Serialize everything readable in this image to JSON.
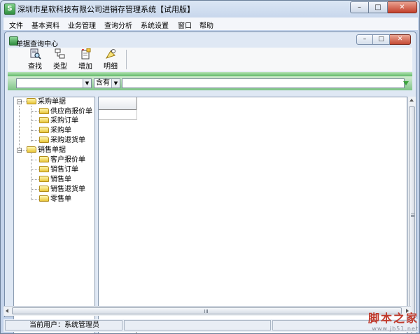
{
  "window": {
    "title": "深圳市星软科技有限公司进销存管理系统【试用版】",
    "controls": {
      "minimize": "–",
      "maximize": "□",
      "close": "✕"
    }
  },
  "menu": [
    "文件",
    "基本资料",
    "业务管理",
    "查询分析",
    "系统设置",
    "窗口",
    "帮助"
  ],
  "child_window": {
    "title": "单据查询中心",
    "controls": {
      "minimize": "–",
      "maximize": "□",
      "close": "✕"
    }
  },
  "toolbar": [
    {
      "label": "查找",
      "icon": "search-icon"
    },
    {
      "label": "类型",
      "icon": "type-icon"
    },
    {
      "label": "增加",
      "icon": "add-icon"
    },
    {
      "label": "明细",
      "icon": "detail-icon"
    }
  ],
  "filter": {
    "field_value": "",
    "operator_value": "含有",
    "search_value": ""
  },
  "tree": {
    "groups": [
      {
        "label": "采购单据",
        "expander": "−",
        "items": [
          "供应商报价单",
          "采购订单",
          "采购单",
          "采购退货单"
        ]
      },
      {
        "label": "销售单据",
        "expander": "−",
        "items": [
          "客户报价单",
          "销售订单",
          "销售单",
          "销售退货单",
          "零售单"
        ]
      }
    ]
  },
  "status": {
    "current_user": "当前用户：系统管理员"
  },
  "watermark": {
    "text": "脚本之家",
    "url": "www.jb51.net"
  },
  "colors": {
    "accent_green": "#5fb968",
    "title_bar": "#c3d3ea",
    "close_red": "#c3402b"
  }
}
